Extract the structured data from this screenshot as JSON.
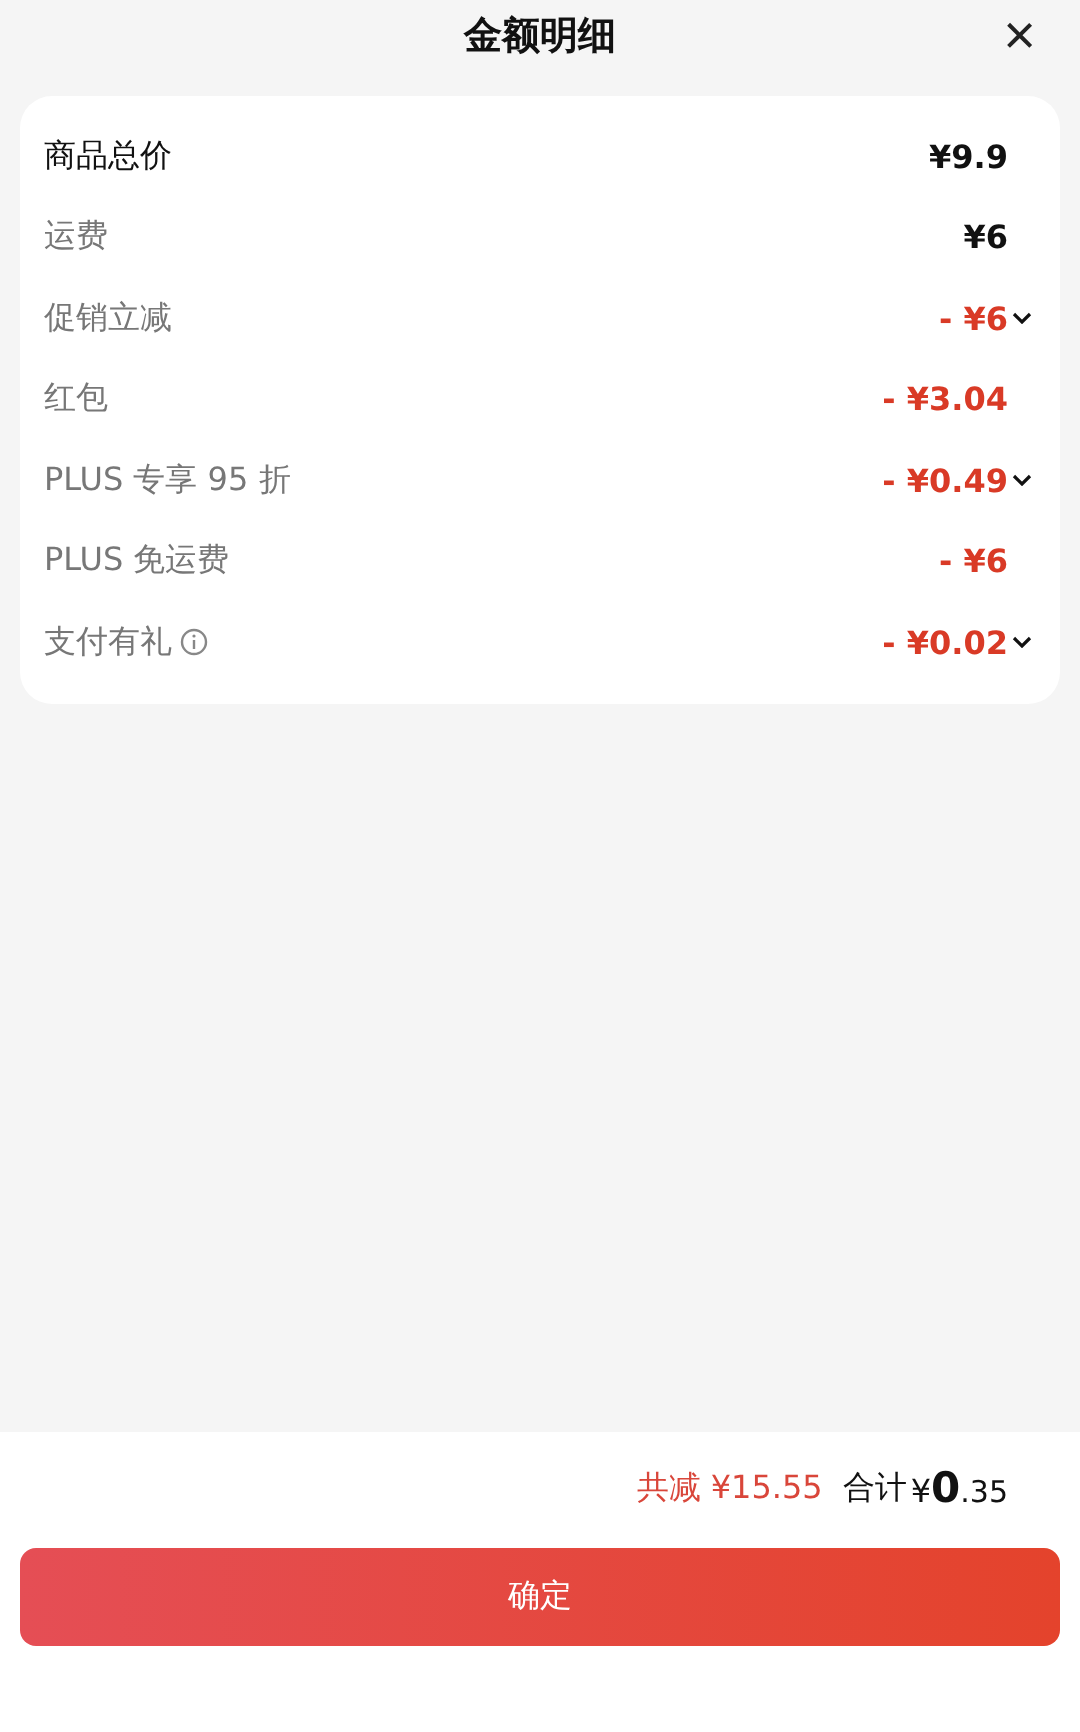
{
  "title": "金额明细",
  "close": "×",
  "rows": [
    {
      "label": "商品总价",
      "amount": "¥9.9",
      "kind": "total",
      "expandable": false,
      "info": false
    },
    {
      "label": "运费",
      "amount": "¥6",
      "kind": "charge",
      "expandable": false,
      "info": false
    },
    {
      "label": "促销立减",
      "amount": "- ¥6",
      "kind": "discount",
      "expandable": true,
      "info": false
    },
    {
      "label": "红包",
      "amount": "- ¥3.04",
      "kind": "discount",
      "expandable": false,
      "info": false
    },
    {
      "label": "PLUS 专享 95 折",
      "amount": "- ¥0.49",
      "kind": "discount",
      "expandable": true,
      "info": false
    },
    {
      "label": "PLUS 免运费",
      "amount": "- ¥6",
      "kind": "discount",
      "expandable": false,
      "info": false
    },
    {
      "label": "支付有礼",
      "amount": "- ¥0.02",
      "kind": "discount",
      "expandable": true,
      "info": true
    }
  ],
  "summary": {
    "saved": "共减 ¥15.55",
    "total_label": "合计",
    "currency": "¥",
    "integer": "0",
    "fraction": ".35"
  },
  "confirm": "确定"
}
